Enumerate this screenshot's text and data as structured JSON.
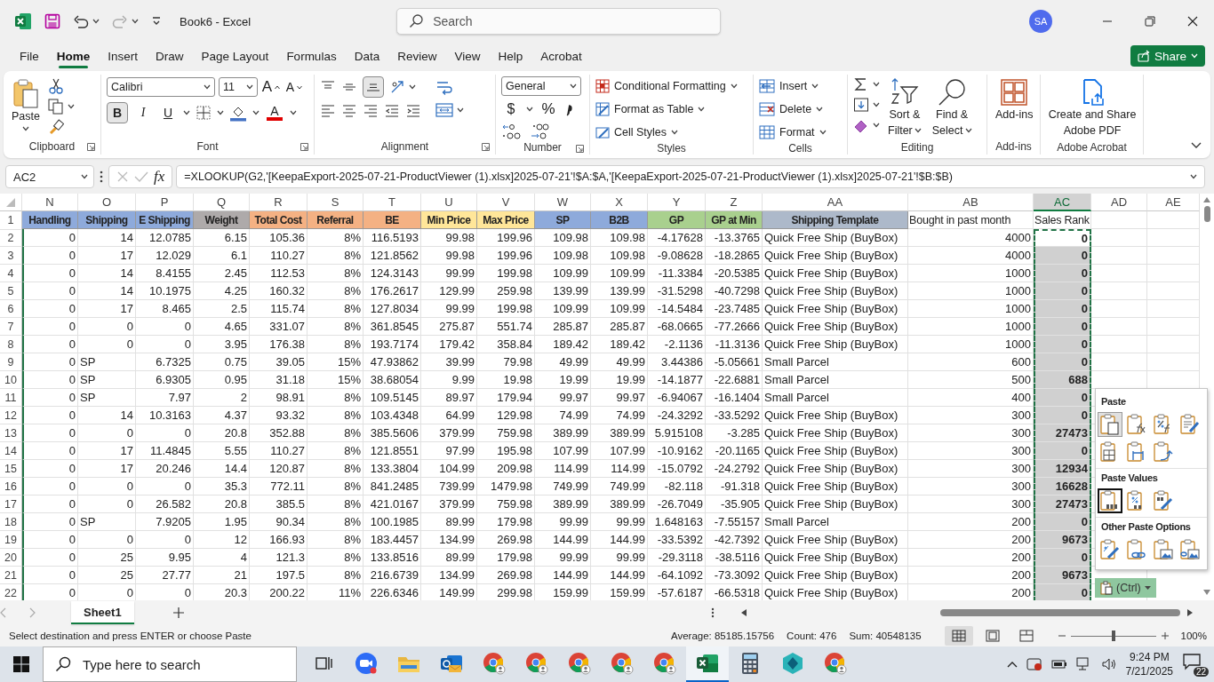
{
  "title_bar": {
    "title": "Book6  -  Excel",
    "search": {
      "placeholder": "Search"
    },
    "avatar": "SA"
  },
  "menu_tabs": [
    {
      "label": "File",
      "selected": false
    },
    {
      "label": "Home",
      "selected": true
    },
    {
      "label": "Insert",
      "selected": false
    },
    {
      "label": "Draw",
      "selected": false
    },
    {
      "label": "Page Layout",
      "selected": false
    },
    {
      "label": "Formulas",
      "selected": false
    },
    {
      "label": "Data",
      "selected": false
    },
    {
      "label": "Review",
      "selected": false
    },
    {
      "label": "View",
      "selected": false
    },
    {
      "label": "Help",
      "selected": false
    },
    {
      "label": "Acrobat",
      "selected": false
    }
  ],
  "share": "Share",
  "ribbon": {
    "clipboard": {
      "paste": "Paste",
      "label": "Clipboard"
    },
    "font": {
      "name": "Calibri",
      "size": "11",
      "grow": "A",
      "shrink": "A",
      "bold_label": "B",
      "italic_label": "I",
      "underline_label": "U",
      "color_label": "A",
      "bold": true,
      "label": "Font"
    },
    "alignment": {
      "bottom_align": true,
      "label": "Alignment"
    },
    "number": {
      "format": "General",
      "currency": "$",
      "percent": "%",
      "label": "Number"
    },
    "styles": {
      "items": [
        "Conditional Formatting",
        "Format as Table",
        "Cell Styles"
      ],
      "label": "Styles"
    },
    "cells": {
      "items": [
        "Insert",
        "Delete",
        "Format"
      ],
      "label": "Cells"
    },
    "editing": {
      "sort": [
        "Sort &",
        "Filter"
      ],
      "find": [
        "Find &",
        "Select"
      ],
      "label": "Editing"
    },
    "add_ins": {
      "button": "Add-ins",
      "label": "Add-ins"
    },
    "acrobat": {
      "button": [
        "Create and Share",
        "Adobe PDF"
      ],
      "label": "Adobe Acrobat"
    }
  },
  "formula_bar": {
    "name_box": "AC2",
    "function_label": "fx",
    "formula": "=XLOOKUP(G2,'[KeepaExport-2025-07-21-ProductViewer (1).xlsx]2025-07-21'!$A:$A,'[KeepaExport-2025-07-21-ProductViewer (1).xlsx]2025-07-21'!$B:$B)"
  },
  "sheet": {
    "columns": [
      {
        "letter": "N",
        "selected": false
      },
      {
        "letter": "O",
        "selected": false
      },
      {
        "letter": "P",
        "selected": false
      },
      {
        "letter": "Q",
        "selected": false
      },
      {
        "letter": "R",
        "selected": false
      },
      {
        "letter": "S",
        "selected": false
      },
      {
        "letter": "T",
        "selected": false
      },
      {
        "letter": "U",
        "selected": false
      },
      {
        "letter": "V",
        "selected": false
      },
      {
        "letter": "W",
        "selected": false
      },
      {
        "letter": "X",
        "selected": false
      },
      {
        "letter": "Y",
        "selected": false
      },
      {
        "letter": "Z",
        "selected": false
      },
      {
        "letter": "AA",
        "selected": false
      },
      {
        "letter": "AB",
        "selected": false
      },
      {
        "letter": "AC",
        "selected": true
      },
      {
        "letter": "AD",
        "selected": false
      },
      {
        "letter": "AE",
        "selected": false
      }
    ],
    "header_row": {
      "number": "1",
      "cells": [
        {
          "text": "Handling",
          "color": "#8eaadb"
        },
        {
          "text": "Shipping",
          "color": "#8eaadb"
        },
        {
          "text": "E Shipping",
          "color": "#8eaadb"
        },
        {
          "text": "Weight",
          "color": "#aeaaaa"
        },
        {
          "text": "Total Cost",
          "color": "#f4b183"
        },
        {
          "text": "Referral",
          "color": "#f4b183"
        },
        {
          "text": "BE",
          "color": "#f4b183"
        },
        {
          "text": "Min Price",
          "color": "#ffe699"
        },
        {
          "text": "Max Price",
          "color": "#ffe699"
        },
        {
          "text": "SP",
          "color": "#8eaadb"
        },
        {
          "text": "B2B",
          "color": "#8eaadb"
        },
        {
          "text": "GP",
          "color": "#a9d08e"
        },
        {
          "text": "GP at Min",
          "color": "#a9d08e"
        },
        {
          "text": "Shipping Template",
          "color": "#adb9ca"
        },
        {
          "text": "Bought in past month"
        },
        {
          "text": "Sales Rank"
        }
      ]
    },
    "rows": [
      {
        "number": "2",
        "active": true,
        "cells": [
          "0",
          "14",
          "12.0785",
          "6.15",
          "105.36",
          "8%",
          "116.5193",
          "99.98",
          "199.96",
          "109.98",
          "109.98",
          "-4.17628",
          "-13.3765",
          "Quick Free Ship (BuyBox)",
          "4000",
          "0"
        ]
      },
      {
        "number": "3",
        "active": false,
        "cells": [
          "0",
          "17",
          "12.029",
          "6.1",
          "110.27",
          "8%",
          "121.8562",
          "99.98",
          "199.96",
          "109.98",
          "109.98",
          "-9.08628",
          "-18.2865",
          "Quick Free Ship (BuyBox)",
          "4000",
          "0"
        ]
      },
      {
        "number": "4",
        "active": false,
        "cells": [
          "0",
          "14",
          "8.4155",
          "2.45",
          "112.53",
          "8%",
          "124.3143",
          "99.99",
          "199.98",
          "109.99",
          "109.99",
          "-11.3384",
          "-20.5385",
          "Quick Free Ship (BuyBox)",
          "1000",
          "0"
        ]
      },
      {
        "number": "5",
        "active": false,
        "cells": [
          "0",
          "14",
          "10.1975",
          "4.25",
          "160.32",
          "8%",
          "176.2617",
          "129.99",
          "259.98",
          "139.99",
          "139.99",
          "-31.5298",
          "-40.7298",
          "Quick Free Ship (BuyBox)",
          "1000",
          "0"
        ]
      },
      {
        "number": "6",
        "active": false,
        "cells": [
          "0",
          "17",
          "8.465",
          "2.5",
          "115.74",
          "8%",
          "127.8034",
          "99.99",
          "199.98",
          "109.99",
          "109.99",
          "-14.5484",
          "-23.7485",
          "Quick Free Ship (BuyBox)",
          "1000",
          "0"
        ]
      },
      {
        "number": "7",
        "active": false,
        "cells": [
          "0",
          "0",
          "0",
          "4.65",
          "331.07",
          "8%",
          "361.8545",
          "275.87",
          "551.74",
          "285.87",
          "285.87",
          "-68.0665",
          "-77.2666",
          "Quick Free Ship (BuyBox)",
          "1000",
          "0"
        ]
      },
      {
        "number": "8",
        "active": false,
        "cells": [
          "0",
          "0",
          "0",
          "3.95",
          "176.38",
          "8%",
          "193.7174",
          "179.42",
          "358.84",
          "189.42",
          "189.42",
          "-2.1136",
          "-11.3136",
          "Quick Free Ship (BuyBox)",
          "1000",
          "0"
        ]
      },
      {
        "number": "9",
        "active": false,
        "cells": [
          "0",
          "SP",
          "6.7325",
          "0.75",
          "39.05",
          "15%",
          "47.93862",
          "39.99",
          "79.98",
          "49.99",
          "49.99",
          "3.44386",
          "-5.05661",
          "Small Parcel",
          "600",
          "0"
        ]
      },
      {
        "number": "10",
        "active": false,
        "cells": [
          "0",
          "SP",
          "6.9305",
          "0.95",
          "31.18",
          "15%",
          "38.68054",
          "9.99",
          "19.98",
          "19.99",
          "19.99",
          "-14.1877",
          "-22.6881",
          "Small Parcel",
          "500",
          "688"
        ]
      },
      {
        "number": "11",
        "active": false,
        "cells": [
          "0",
          "SP",
          "7.97",
          "2",
          "98.91",
          "8%",
          "109.5145",
          "89.97",
          "179.94",
          "99.97",
          "99.97",
          "-6.94067",
          "-16.1404",
          "Small Parcel",
          "400",
          "0"
        ]
      },
      {
        "number": "12",
        "active": false,
        "cells": [
          "0",
          "14",
          "10.3163",
          "4.37",
          "93.32",
          "8%",
          "103.4348",
          "64.99",
          "129.98",
          "74.99",
          "74.99",
          "-24.3292",
          "-33.5292",
          "Quick Free Ship (BuyBox)",
          "300",
          "0"
        ]
      },
      {
        "number": "13",
        "active": false,
        "cells": [
          "0",
          "0",
          "0",
          "20.8",
          "352.88",
          "8%",
          "385.5606",
          "379.99",
          "759.98",
          "389.99",
          "389.99",
          "5.915108",
          "-3.285",
          "Quick Free Ship (BuyBox)",
          "300",
          "27473"
        ]
      },
      {
        "number": "14",
        "active": false,
        "cells": [
          "0",
          "17",
          "11.4845",
          "5.55",
          "110.27",
          "8%",
          "121.8551",
          "97.99",
          "195.98",
          "107.99",
          "107.99",
          "-10.9162",
          "-20.1165",
          "Quick Free Ship (BuyBox)",
          "300",
          "0"
        ]
      },
      {
        "number": "15",
        "active": false,
        "cells": [
          "0",
          "17",
          "20.246",
          "14.4",
          "120.87",
          "8%",
          "133.3804",
          "104.99",
          "209.98",
          "114.99",
          "114.99",
          "-15.0792",
          "-24.2792",
          "Quick Free Ship (BuyBox)",
          "300",
          "12934"
        ]
      },
      {
        "number": "16",
        "active": false,
        "cells": [
          "0",
          "0",
          "0",
          "35.3",
          "772.11",
          "8%",
          "841.2485",
          "739.99",
          "1479.98",
          "749.99",
          "749.99",
          "-82.118",
          "-91.318",
          "Quick Free Ship (BuyBox)",
          "300",
          "16628"
        ]
      },
      {
        "number": "17",
        "active": false,
        "cells": [
          "0",
          "0",
          "26.582",
          "20.8",
          "385.5",
          "8%",
          "421.0167",
          "379.99",
          "759.98",
          "389.99",
          "389.99",
          "-26.7049",
          "-35.905",
          "Quick Free Ship (BuyBox)",
          "300",
          "27473"
        ]
      },
      {
        "number": "18",
        "active": false,
        "cells": [
          "0",
          "SP",
          "7.9205",
          "1.95",
          "90.34",
          "8%",
          "100.1985",
          "89.99",
          "179.98",
          "99.99",
          "99.99",
          "1.648163",
          "-7.55157",
          "Small Parcel",
          "200",
          "0"
        ]
      },
      {
        "number": "19",
        "active": false,
        "cells": [
          "0",
          "0",
          "0",
          "12",
          "166.93",
          "8%",
          "183.4457",
          "134.99",
          "269.98",
          "144.99",
          "144.99",
          "-33.5392",
          "-42.7392",
          "Quick Free Ship (BuyBox)",
          "200",
          "9673"
        ]
      },
      {
        "number": "20",
        "active": false,
        "cells": [
          "0",
          "25",
          "9.95",
          "4",
          "121.3",
          "8%",
          "133.8516",
          "89.99",
          "179.98",
          "99.99",
          "99.99",
          "-29.3118",
          "-38.5116",
          "Quick Free Ship (BuyBox)",
          "200",
          "0"
        ]
      },
      {
        "number": "21",
        "active": false,
        "cells": [
          "0",
          "25",
          "27.77",
          "21",
          "197.5",
          "8%",
          "216.6739",
          "134.99",
          "269.98",
          "144.99",
          "144.99",
          "-64.1092",
          "-73.3092",
          "Quick Free Ship (BuyBox)",
          "200",
          "9673"
        ]
      },
      {
        "number": "22",
        "active": false,
        "cells": [
          "0",
          "0",
          "0",
          "20.3",
          "200.22",
          "11%",
          "226.6346",
          "149.99",
          "299.98",
          "159.99",
          "159.99",
          "-57.6187",
          "-66.5318",
          "Quick Free Ship (BuyBox)",
          "200",
          "0"
        ]
      }
    ]
  },
  "paste_menu": {
    "sections": [
      {
        "title": "Paste",
        "options": [
          {
            "kind": "all",
            "hovered": true,
            "selected": false
          },
          {
            "kind": "formulas",
            "hovered": false,
            "selected": false
          },
          {
            "kind": "formulas-format",
            "hovered": false,
            "selected": false
          },
          {
            "kind": "source-format",
            "hovered": false,
            "selected": false
          },
          {
            "kind": "no-borders",
            "hovered": false,
            "selected": false
          },
          {
            "kind": "column-widths",
            "hovered": false,
            "selected": false
          },
          {
            "kind": "transpose",
            "hovered": false,
            "selected": false
          }
        ]
      },
      {
        "title": "Paste Values",
        "options": [
          {
            "kind": "values",
            "hovered": false,
            "selected": true
          },
          {
            "kind": "values-format",
            "hovered": false,
            "selected": false
          },
          {
            "kind": "values-source",
            "hovered": false,
            "selected": false
          }
        ]
      },
      {
        "title": "Other Paste Options",
        "options": [
          {
            "kind": "formatting",
            "hovered": false,
            "selected": false
          },
          {
            "kind": "link",
            "hovered": false,
            "selected": false
          },
          {
            "kind": "picture",
            "hovered": false,
            "selected": false
          },
          {
            "kind": "linked-picture",
            "hovered": false,
            "selected": false
          }
        ]
      }
    ]
  },
  "ctrl_button": "(Ctrl)",
  "sheet_tabs": [
    {
      "label": "Sheet1",
      "selected": true
    }
  ],
  "status_bar": {
    "message": "Select destination and press ENTER or choose Paste",
    "average": "Average: 85185.15756",
    "count": "Count: 476",
    "sum": "Sum: 40548135",
    "views": [
      {
        "kind": "normal",
        "selected": true
      },
      {
        "kind": "page-layout",
        "selected": false
      },
      {
        "kind": "page-break",
        "selected": false
      }
    ],
    "zoom": {
      "level": 0.5,
      "label": "100%"
    }
  },
  "taskbar": {
    "search_placeholder": "Type here to search",
    "apps": [
      {
        "kind": "task-view",
        "active": false
      },
      {
        "kind": "video",
        "active": false
      },
      {
        "kind": "folder",
        "active": false
      },
      {
        "kind": "mail",
        "active": false
      },
      {
        "kind": "browser",
        "active": false
      },
      {
        "kind": "browser",
        "active": false
      },
      {
        "kind": "browser",
        "active": false
      },
      {
        "kind": "browser",
        "active": false
      },
      {
        "kind": "browser",
        "active": false
      },
      {
        "kind": "sheet",
        "active": true
      },
      {
        "kind": "calculator",
        "active": false
      },
      {
        "kind": "hexagon",
        "active": false
      },
      {
        "kind": "browser",
        "active": false
      }
    ],
    "time": "9:24 PM",
    "date": "7/21/2025",
    "notifications": "22"
  }
}
